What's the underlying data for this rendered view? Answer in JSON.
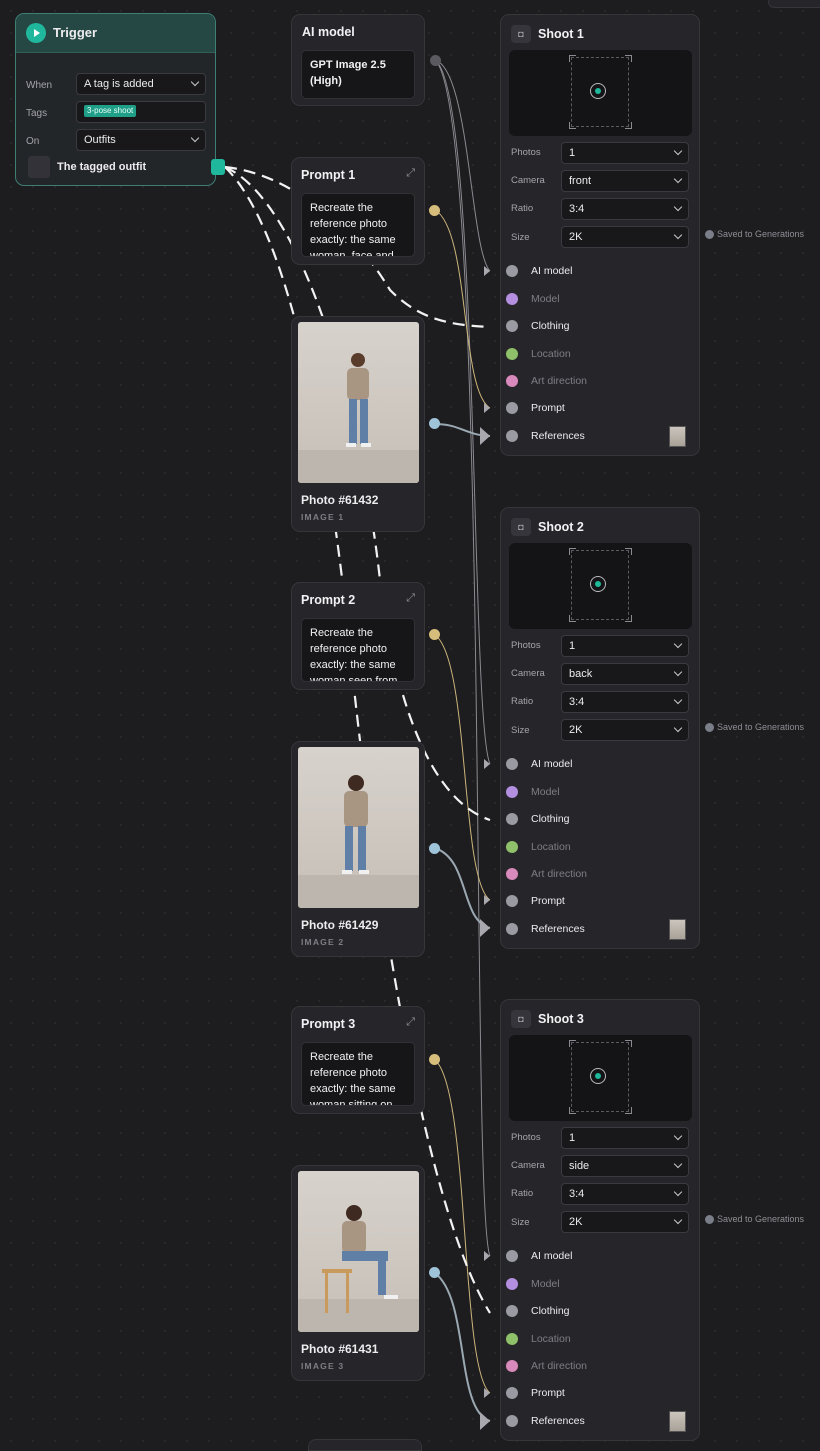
{
  "colors": {
    "accent_teal": "#20b89c",
    "port_gray": "#9a9aa2",
    "port_purple": "#b48fe0",
    "port_green": "#8fc06a",
    "port_pink": "#d98abd",
    "port_yellow": "#d7bd7c",
    "port_blue": "#9fc3d8"
  },
  "trigger": {
    "title": "Trigger",
    "when_label": "When",
    "when_value": "A tag is added",
    "tags_label": "Tags",
    "tags_value": "3-pose shoot",
    "on_label": "On",
    "on_value": "Outfits",
    "output_label": "The tagged outfit"
  },
  "ai_model": {
    "title": "AI model",
    "value": "GPT Image 2.5 (High)"
  },
  "prompts": [
    {
      "title": "Prompt 1",
      "text": "Recreate the reference photo exactly: the same woman, face and"
    },
    {
      "title": "Prompt 2",
      "text": "Recreate the reference photo exactly: the same woman seen from"
    },
    {
      "title": "Prompt 3",
      "text": "Recreate the reference photo exactly: the same woman sitting on"
    }
  ],
  "photos": [
    {
      "title": "Photo #61432",
      "sub": "IMAGE 1",
      "pose": "front"
    },
    {
      "title": "Photo #61429",
      "sub": "IMAGE 2",
      "pose": "back"
    },
    {
      "title": "Photo #61431",
      "sub": "IMAGE 3",
      "pose": "sitting"
    }
  ],
  "shoot_labels": {
    "photos": "Photos",
    "camera": "Camera",
    "ratio": "Ratio",
    "size": "Size",
    "inputs": [
      "AI model",
      "Model",
      "Clothing",
      "Location",
      "Art direction",
      "Prompt",
      "References"
    ]
  },
  "shoots": [
    {
      "title": "Shoot 1",
      "photos": "1",
      "camera": "front",
      "ratio": "3:4",
      "size": "2K",
      "saved": "Saved to Generations"
    },
    {
      "title": "Shoot 2",
      "photos": "1",
      "camera": "back",
      "ratio": "3:4",
      "size": "2K",
      "saved": "Saved to Generations"
    },
    {
      "title": "Shoot 3",
      "photos": "1",
      "camera": "side",
      "ratio": "3:4",
      "size": "2K",
      "saved": "Saved to Generations"
    }
  ]
}
